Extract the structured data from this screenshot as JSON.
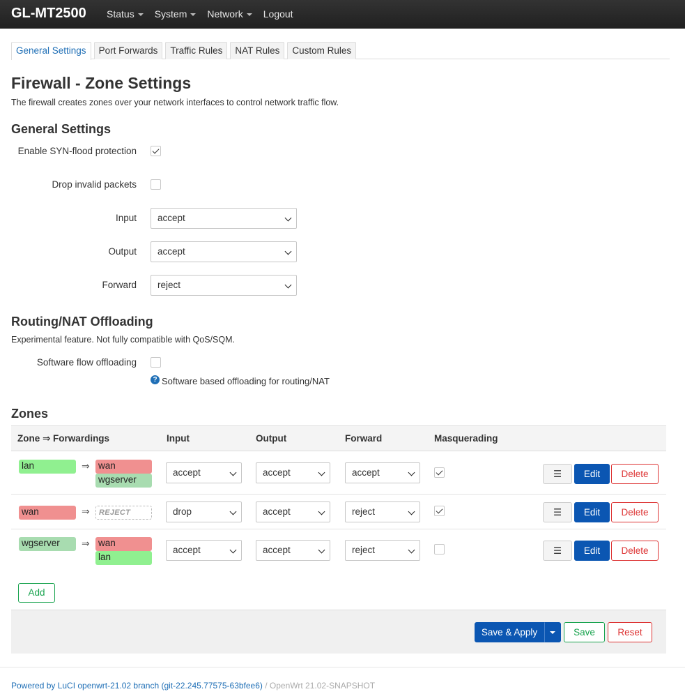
{
  "brand": "GL-MT2500",
  "menu": [
    "Status",
    "System",
    "Network",
    "Logout"
  ],
  "tabs": [
    "General Settings",
    "Port Forwards",
    "Traffic Rules",
    "NAT Rules",
    "Custom Rules"
  ],
  "page": {
    "title": "Firewall - Zone Settings",
    "description": "The firewall creates zones over your network interfaces to control network traffic flow."
  },
  "general": {
    "heading": "General Settings",
    "syn_label": "Enable SYN-flood protection",
    "syn_checked": true,
    "drop_label": "Drop invalid packets",
    "drop_checked": false,
    "input_label": "Input",
    "input_value": "accept",
    "output_label": "Output",
    "output_value": "accept",
    "forward_label": "Forward",
    "forward_value": "reject"
  },
  "offload": {
    "heading": "Routing/NAT Offloading",
    "description": "Experimental feature. Not fully compatible with QoS/SQM.",
    "sw_label": "Software flow offloading",
    "sw_checked": false,
    "help": "Software based offloading for routing/NAT",
    "help_icon": "question-icon"
  },
  "zones": {
    "heading": "Zones",
    "columns": [
      "Zone ⇒ Forwardings",
      "Input",
      "Output",
      "Forward",
      "Masquerading"
    ],
    "arrow": "⇒",
    "rows": [
      {
        "zone": "lan",
        "fwd1": "wan",
        "fwd2": "wgserver",
        "input": "accept",
        "output": "accept",
        "forward": "accept",
        "masq": true
      },
      {
        "zone": "wan",
        "fwd1": "REJECT",
        "fwd2": "",
        "input": "drop",
        "output": "accept",
        "forward": "reject",
        "masq": true
      },
      {
        "zone": "wgserver",
        "fwd1": "wan",
        "fwd2": "lan",
        "input": "accept",
        "output": "accept",
        "forward": "reject",
        "masq": false
      }
    ],
    "menu_glyph": "☰",
    "edit_label": "Edit",
    "delete_label": "Delete",
    "add_label": "Add"
  },
  "actions": {
    "apply_label": "Save & Apply",
    "save_label": "Save",
    "reset_label": "Reset"
  },
  "footer": {
    "powered": "Powered by LuCI openwrt-21.02 branch (git-22.245.77575-63bfee6)",
    "version": " / OpenWrt 21.02-SNAPSHOT"
  },
  "colors": {
    "lan": "#90f090",
    "wan": "#f09090",
    "wgserver": "#a8dcb0",
    "primary": "#0b56b2",
    "danger": "#dd3333",
    "success": "#18a34e"
  }
}
